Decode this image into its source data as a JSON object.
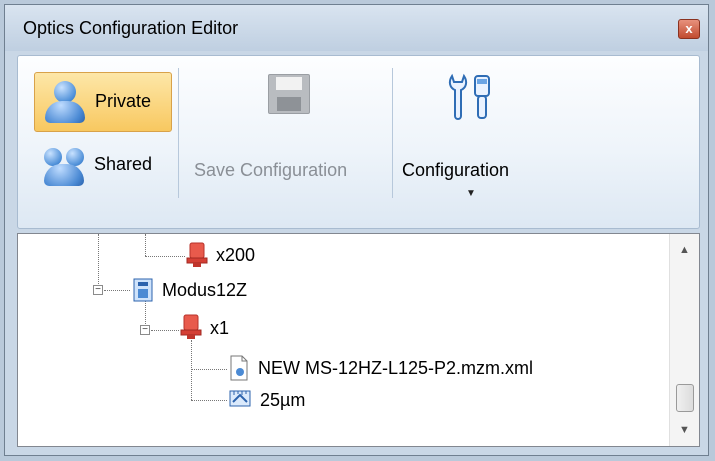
{
  "window": {
    "title": "Optics Configuration Editor",
    "close_glyph": "x"
  },
  "toolbar": {
    "private_label": "Private",
    "shared_label": "Shared",
    "save_label": "Save Configuration",
    "configuration_label": "Configuration",
    "dropdown_glyph": "▼"
  },
  "tree": {
    "items": [
      {
        "label": "x200",
        "icon": "objective-lens-icon"
      },
      {
        "label": "Modus12Z",
        "icon": "microscope-module-icon",
        "expanded": true
      },
      {
        "label": "x1",
        "icon": "objective-lens-icon",
        "expanded": true
      },
      {
        "label": "NEW MS-12HZ-L125-P2.mzm.xml",
        "icon": "file-icon"
      },
      {
        "label": "25µm",
        "icon": "calibration-icon"
      }
    ],
    "expander_glyph": "−"
  },
  "scrollbar": {
    "up_glyph": "▲",
    "down_glyph": "▼"
  },
  "colors": {
    "accent": "#f8c860",
    "title_bg": "#c9d7e6",
    "lens_red": "#e0453a"
  }
}
